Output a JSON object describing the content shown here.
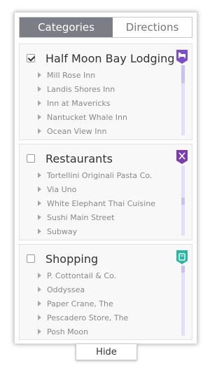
{
  "tabs": {
    "categories": "Categories",
    "directions": "Directions"
  },
  "sections": [
    {
      "title": "Half Moon Bay Lodging",
      "checked": true,
      "badge_color": "#7b4fc8",
      "icon": "bed-icon",
      "items": [
        "Mill Rose Inn",
        "Landis Shores Inn",
        "Inn at Mavericks",
        "Nantucket Whale Inn",
        "Ocean View Inn"
      ]
    },
    {
      "title": "Restaurants",
      "checked": false,
      "badge_color": "#7b3ea8",
      "icon": "fork-knife-icon",
      "items": [
        "Tortellini Originali Pasta Co.",
        "Via Uno",
        "White Elephant Thai Cuisine",
        "Sushi Main Street",
        "Subway"
      ]
    },
    {
      "title": "Shopping",
      "checked": false,
      "badge_color": "#2bb5a2",
      "icon": "shopping-bag-icon",
      "items": [
        "P. Cottontail & Co.",
        "Oddyssea",
        "Paper Crane, The",
        "Pescadero Store, The",
        "Posh Moon"
      ]
    }
  ],
  "hide_label": "Hide"
}
